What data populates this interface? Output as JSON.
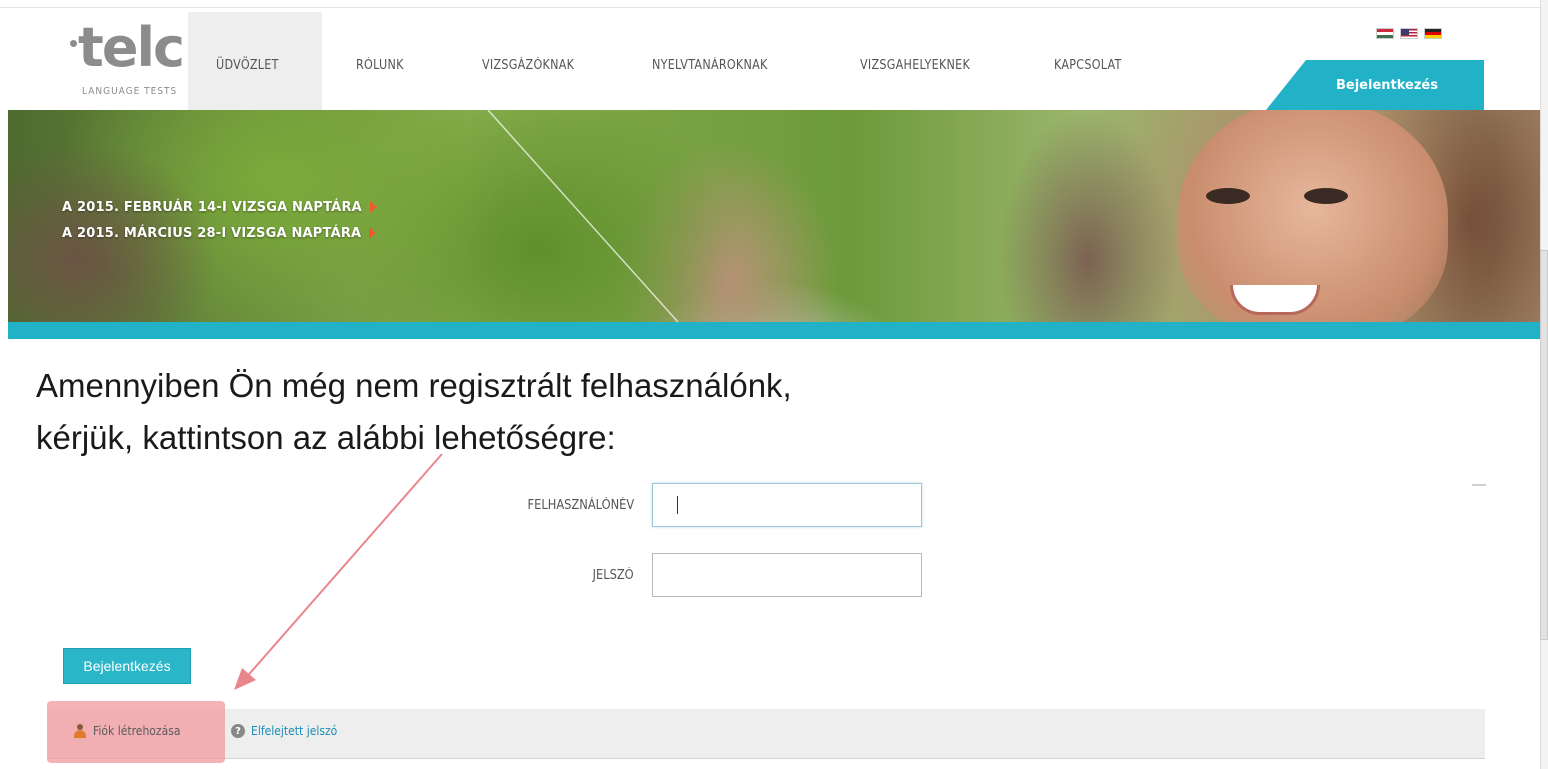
{
  "brand": {
    "logo_text": "telc",
    "logo_subtext": "LANGUAGE TESTS"
  },
  "nav": {
    "items": [
      {
        "label": "ÜDVÖZLET",
        "active": true
      },
      {
        "label": "RÓLUNK",
        "active": false
      },
      {
        "label": "VIZSGÁZÓKNAK",
        "active": false
      },
      {
        "label": "NYELVTANÁROKNAK",
        "active": false
      },
      {
        "label": "VIZSGAHELYEKNEK",
        "active": false
      },
      {
        "label": "KAPCSOLAT",
        "active": false
      }
    ],
    "login_tab_label": "Bejelentkezés",
    "languages": [
      "hu-flag-icon",
      "us-flag-icon",
      "de-flag-icon"
    ]
  },
  "banner": {
    "links": [
      "A 2015. FEBRUÁR 14-I VIZSGA NAPTÁRA",
      "A 2015. MÁRCIUS 28-I VIZSGA NAPTÁRA"
    ]
  },
  "instruction": {
    "line1": "Amennyiben Ön még nem regisztrált felhasználónk,",
    "line2": "kérjük, kattintson az alábbi lehetőségre:"
  },
  "form": {
    "username_label": "FELHASZNÁLÓNÉV",
    "username_value": "",
    "password_label": "JELSZÓ",
    "password_value": "",
    "submit_label": "Bejelentkezés"
  },
  "footer_links": {
    "create_account": "Fiók létrehozása",
    "forgot_password": "Elfelejtett jelszó"
  },
  "colors": {
    "accent": "#22b2c8",
    "banner_arrow": "#f05a28",
    "highlight": "#f29aa0",
    "annotation_arrow": "#e9868c"
  }
}
